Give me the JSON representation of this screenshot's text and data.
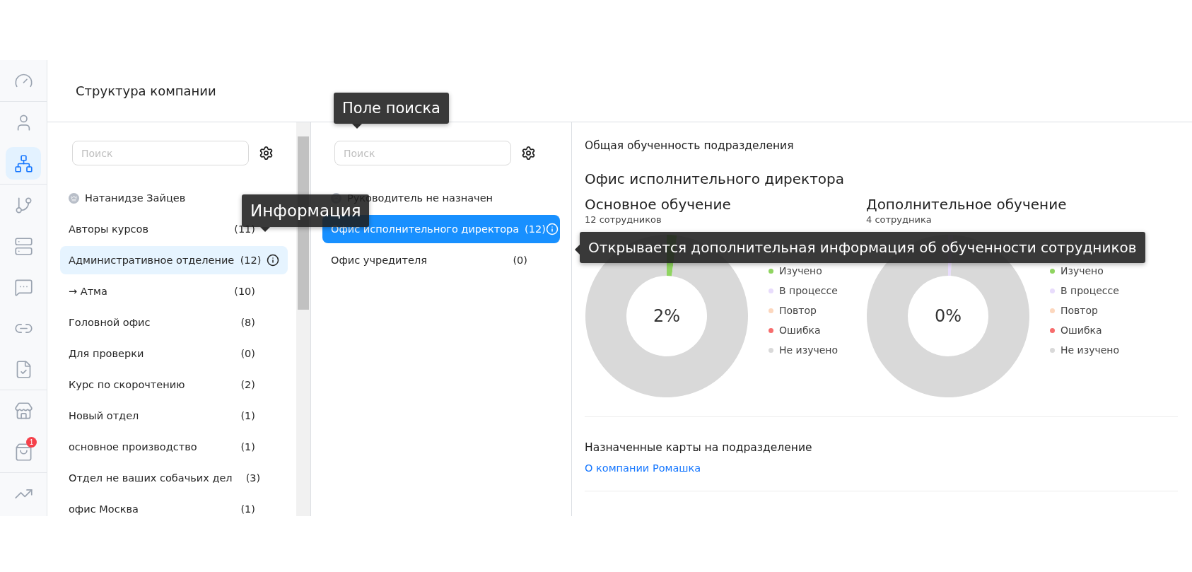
{
  "sidebar": {
    "items": [
      {
        "selected": false
      },
      {
        "selected": false
      },
      {
        "selected": true
      },
      {
        "selected": false
      },
      {
        "selected": false
      },
      {
        "selected": false
      },
      {
        "selected": false
      },
      {
        "selected": false
      },
      {
        "selected": false
      },
      {
        "selected": false,
        "badge": "1"
      },
      {
        "selected": false
      }
    ]
  },
  "header": {
    "title": "Структура компании"
  },
  "left_panel": {
    "search": {
      "placeholder": "Поиск"
    },
    "head": {
      "name": "Натанидзе Зайцев"
    },
    "items": [
      {
        "label": "Авторы курсов",
        "count": "(11)",
        "selected": false
      },
      {
        "label": "Административное отделение",
        "count": "(12)",
        "selected": true
      },
      {
        "label": "→ Атма",
        "count": "(10)",
        "selected": false
      },
      {
        "label": "Головной офис",
        "count": "(8)",
        "selected": false
      },
      {
        "label": "Для проверки",
        "count": "(0)",
        "selected": false
      },
      {
        "label": "Курс по скорочтению",
        "count": "(2)",
        "selected": false
      },
      {
        "label": "Новый отдел",
        "count": "(1)",
        "selected": false
      },
      {
        "label": "основное производство",
        "count": "(1)",
        "selected": false
      },
      {
        "label": "Отдел не ваших собачьих дел",
        "count": "(3)",
        "selected": false
      },
      {
        "label": "офис Москва",
        "count": "(1)",
        "selected": false
      }
    ]
  },
  "middle_panel": {
    "search": {
      "placeholder": "Поиск"
    },
    "head": {
      "name": "Руководитель не назначен"
    },
    "items": [
      {
        "label": "Офис исполнительного директора",
        "count": "(12)",
        "selected": true
      },
      {
        "label": "Офис учредителя",
        "count": "(0)",
        "selected": false
      }
    ]
  },
  "details": {
    "section_title": "Общая обученность подразделения",
    "unit_title": "Офис исполнительного директора",
    "charts": [
      {
        "title": "Основное обучение",
        "employees": "12 сотрудников",
        "center_label": "2%",
        "legend": [
          {
            "label": "Изучено",
            "color": "#8fd460"
          },
          {
            "label": "В процессе",
            "color": "#e8dcfc"
          },
          {
            "label": "Повтор",
            "color": "#fcd7be"
          },
          {
            "label": "Ошибка",
            "color": "#f76d6d"
          },
          {
            "label": "Не изучено",
            "color": "#d9d9d9"
          }
        ]
      },
      {
        "title": "Дополнительное обучение",
        "employees": "4 сотрудника",
        "center_label": "0%",
        "legend": [
          {
            "label": "Изучено",
            "color": "#8fd460"
          },
          {
            "label": "В процессе",
            "color": "#e8dcfc"
          },
          {
            "label": "Повтор",
            "color": "#fcd7be"
          },
          {
            "label": "Ошибка",
            "color": "#f76d6d"
          },
          {
            "label": "Не изучено",
            "color": "#d9d9d9"
          }
        ]
      }
    ],
    "assigned_title": "Назначенные карты на подразделение",
    "assigned_links": [
      "О компании Ромашка"
    ]
  },
  "tooltips": [
    {
      "kind": "down",
      "text": "Поле поиска"
    },
    {
      "kind": "down",
      "text": "Информация"
    },
    {
      "kind": "left",
      "text": "Открывается дополнительная информация об обученности сотрудников"
    }
  ]
}
